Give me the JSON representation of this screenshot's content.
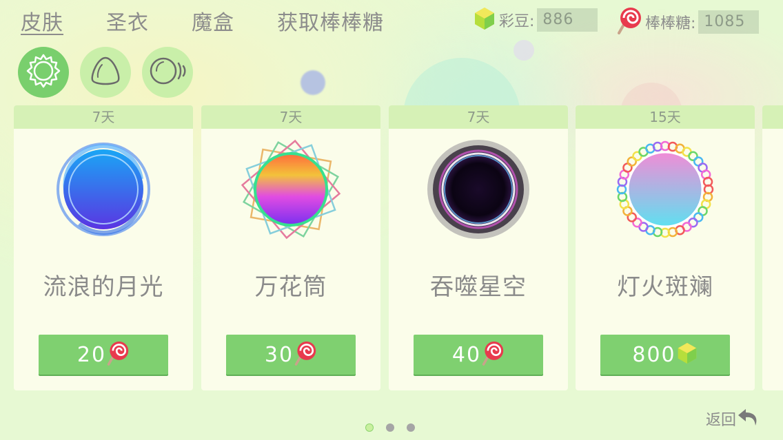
{
  "nav": {
    "tabs": [
      {
        "label": "皮肤",
        "active": true
      },
      {
        "label": "圣衣",
        "active": false
      },
      {
        "label": "魔盒",
        "active": false
      },
      {
        "label": "获取棒棒糖",
        "active": false
      }
    ]
  },
  "currency": {
    "beans_label": "彩豆:",
    "beans_value": "886",
    "candy_label": "棒棒糖:",
    "candy_value": "1085"
  },
  "categories": [
    {
      "icon": "sun-skin-icon",
      "active": true
    },
    {
      "icon": "blob-shape-icon",
      "active": false
    },
    {
      "icon": "moving-ball-icon",
      "active": false
    }
  ],
  "items": [
    {
      "duration": "7天",
      "name": "流浪的月光",
      "price": "20",
      "currency_icon": "lollipop-icon"
    },
    {
      "duration": "7天",
      "name": "万花筒",
      "price": "30",
      "currency_icon": "lollipop-icon"
    },
    {
      "duration": "7天",
      "name": "吞噬星空",
      "price": "40",
      "currency_icon": "lollipop-icon"
    },
    {
      "duration": "15天",
      "name": "灯火斑斓",
      "price": "800",
      "currency_icon": "bean-icon"
    }
  ],
  "pager": {
    "pages": 3,
    "current": 1
  },
  "back_label": "返回",
  "colors": {
    "accent_green": "#7fd070",
    "card_header": "#d6f1b6",
    "background": "#e7f9d3"
  }
}
